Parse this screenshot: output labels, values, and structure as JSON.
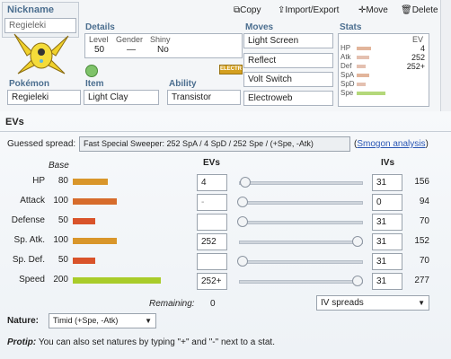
{
  "toolbar": {
    "copy": "Copy",
    "import_export": "Import/Export",
    "move": "Move",
    "delete": "Delete"
  },
  "icons": {
    "copy": "copy-icon",
    "import_export": "upload-icon",
    "move": "move-icon",
    "delete": "trash-icon"
  },
  "nickname": {
    "label": "Nickname",
    "value": "Regieleki"
  },
  "details": {
    "title": "Details",
    "level_label": "Level",
    "level_value": "50",
    "gender_label": "Gender",
    "gender_value": "—",
    "shiny_label": "Shiny",
    "shiny_value": "No"
  },
  "pokemon": {
    "label": "Pokémon",
    "value": "Regieleki"
  },
  "item": {
    "label": "Item",
    "value": "Light Clay"
  },
  "ability": {
    "label": "Ability",
    "value": "Transistor"
  },
  "type_badge": "ELECTR",
  "moves": {
    "title": "Moves",
    "list": [
      "Light Screen",
      "Reflect",
      "Volt Switch",
      "Electroweb"
    ]
  },
  "stats_mini": {
    "title": "Stats",
    "ev_header": "EV",
    "rows": [
      {
        "label": "HP",
        "ev": "4"
      },
      {
        "label": "Atk",
        "ev": ""
      },
      {
        "label": "Def",
        "ev": ""
      },
      {
        "label": "SpA",
        "ev": "252"
      },
      {
        "label": "SpD",
        "ev": ""
      },
      {
        "label": "Spe",
        "ev": "252+"
      }
    ]
  },
  "evs_panel": {
    "title": "EVs",
    "guessed_label": "Guessed spread:",
    "guessed_value": "Fast Special Sweeper: 252 SpA / 4 SpD / 252 Spe / (+Spe, -Atk)",
    "smogon_link": "Smogon analysis",
    "col_base": "Base",
    "col_evs": "EVs",
    "col_ivs": "IVs",
    "remaining_label": "Remaining:",
    "remaining_value": "0",
    "iv_spreads": "IV spreads",
    "nature_label": "Nature:",
    "nature_value": "Timid (+Spe, -Atk)",
    "protip_label": "Protip:",
    "protip_text": "You can also set natures by typing \"+\" and \"-\" next to a stat."
  },
  "stats": [
    {
      "name": "HP",
      "base": 80,
      "ev": "4",
      "ev_placeholder": "",
      "iv": "31",
      "total": "156",
      "bar_color": "#d9962a",
      "slider": 0.02
    },
    {
      "name": "Attack",
      "base": 100,
      "ev": "",
      "ev_placeholder": "-",
      "iv": "0",
      "total": "94",
      "bar_color": "#d76c2c",
      "slider": 0.0
    },
    {
      "name": "Defense",
      "base": 50,
      "ev": "",
      "ev_placeholder": "",
      "iv": "31",
      "total": "70",
      "bar_color": "#d9532a",
      "slider": 0.0
    },
    {
      "name": "Sp. Atk.",
      "base": 100,
      "ev": "252",
      "ev_placeholder": "",
      "iv": "31",
      "total": "152",
      "bar_color": "#d9962a",
      "slider": 1.0
    },
    {
      "name": "Sp. Def.",
      "base": 50,
      "ev": "",
      "ev_placeholder": "",
      "iv": "31",
      "total": "70",
      "bar_color": "#d9532a",
      "slider": 0.0
    },
    {
      "name": "Speed",
      "base": 200,
      "ev": "252+",
      "ev_placeholder": "",
      "iv": "31",
      "total": "277",
      "bar_color": "#a9cc2a",
      "slider": 1.0
    }
  ]
}
